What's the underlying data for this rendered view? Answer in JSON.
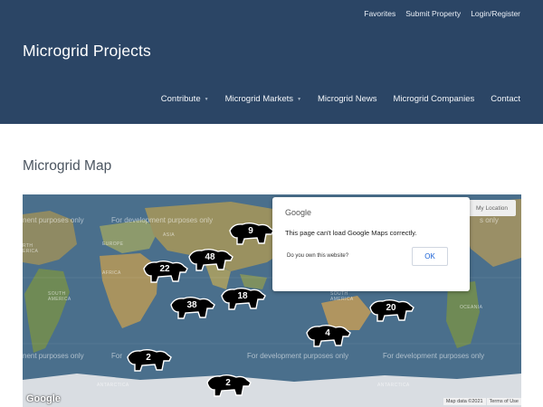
{
  "topnav": [
    "Favorites",
    "Submit Property",
    "Login/Register"
  ],
  "brand": "Microgrid Projects",
  "mainnav": [
    {
      "label": "Contribute",
      "has_dropdown": true
    },
    {
      "label": "Microgrid Markets",
      "has_dropdown": true
    },
    {
      "label": "Microgrid News",
      "has_dropdown": false
    },
    {
      "label": "Microgrid Companies",
      "has_dropdown": false
    },
    {
      "label": "Contact",
      "has_dropdown": false
    }
  ],
  "page_title": "Microgrid Map",
  "map": {
    "watermark": "For development purposes only",
    "watermark_partial": "nent purposes only",
    "watermark_partial_right": "s only",
    "watermark_partial_left2": "For",
    "regions": {
      "asia": "ASIA",
      "europe": "EUROPE",
      "africa": "AFRICA",
      "south_america": "SOUTH AMERICA",
      "south_america_partial": "SOUTH AMERICA",
      "north_america_partial": "RTH ERICA",
      "oceania": "OCEANIA",
      "antarctica": "ANTARCTICA"
    },
    "clusters": [
      "9",
      "48",
      "22",
      "18",
      "38",
      "20",
      "4",
      "2",
      "2"
    ],
    "my_location": "My Location",
    "google_logo": "Google",
    "map_data": "Map data ©2021",
    "terms": "Terms of Use"
  },
  "dialog": {
    "brand": "Google",
    "message": "This page can't load Google Maps correctly.",
    "question": "Do you own this website?",
    "ok_label": "OK"
  },
  "colors": {
    "header_bg": "#2b4565",
    "map_ocean": "#4a6f8c",
    "land": "#9a8f66",
    "link_blue": "#1a62d6"
  }
}
